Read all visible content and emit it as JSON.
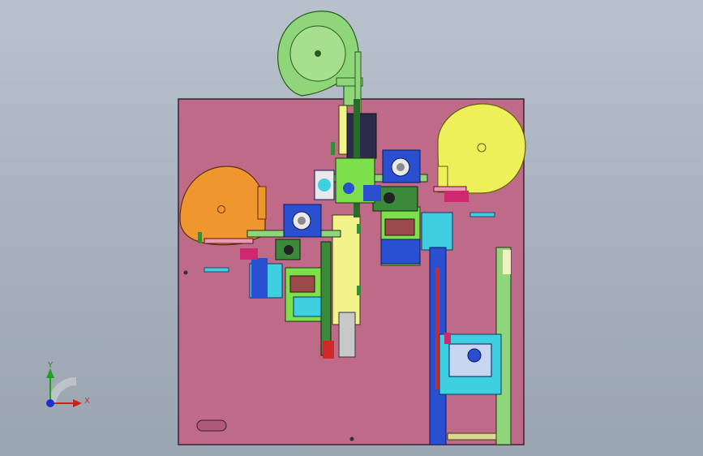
{
  "viewport": {
    "background_top": "#b9c2cc",
    "background_bottom": "#9aa5b2"
  },
  "model": {
    "base_plate_color": "#c06a8a",
    "reel_green_color": "#8fd67a",
    "reel_orange_color": "#f0962e",
    "reel_yellow_color": "#eef05a",
    "frame_blue_color": "#2a4fd0",
    "bracket_cyan_color": "#3ecfe0",
    "bracket_lime_color": "#7be04a"
  },
  "triad": {
    "x_label": "X",
    "y_label": "Y",
    "x_color": "#d02020",
    "y_color": "#20a020",
    "z_color": "#2030d0"
  }
}
